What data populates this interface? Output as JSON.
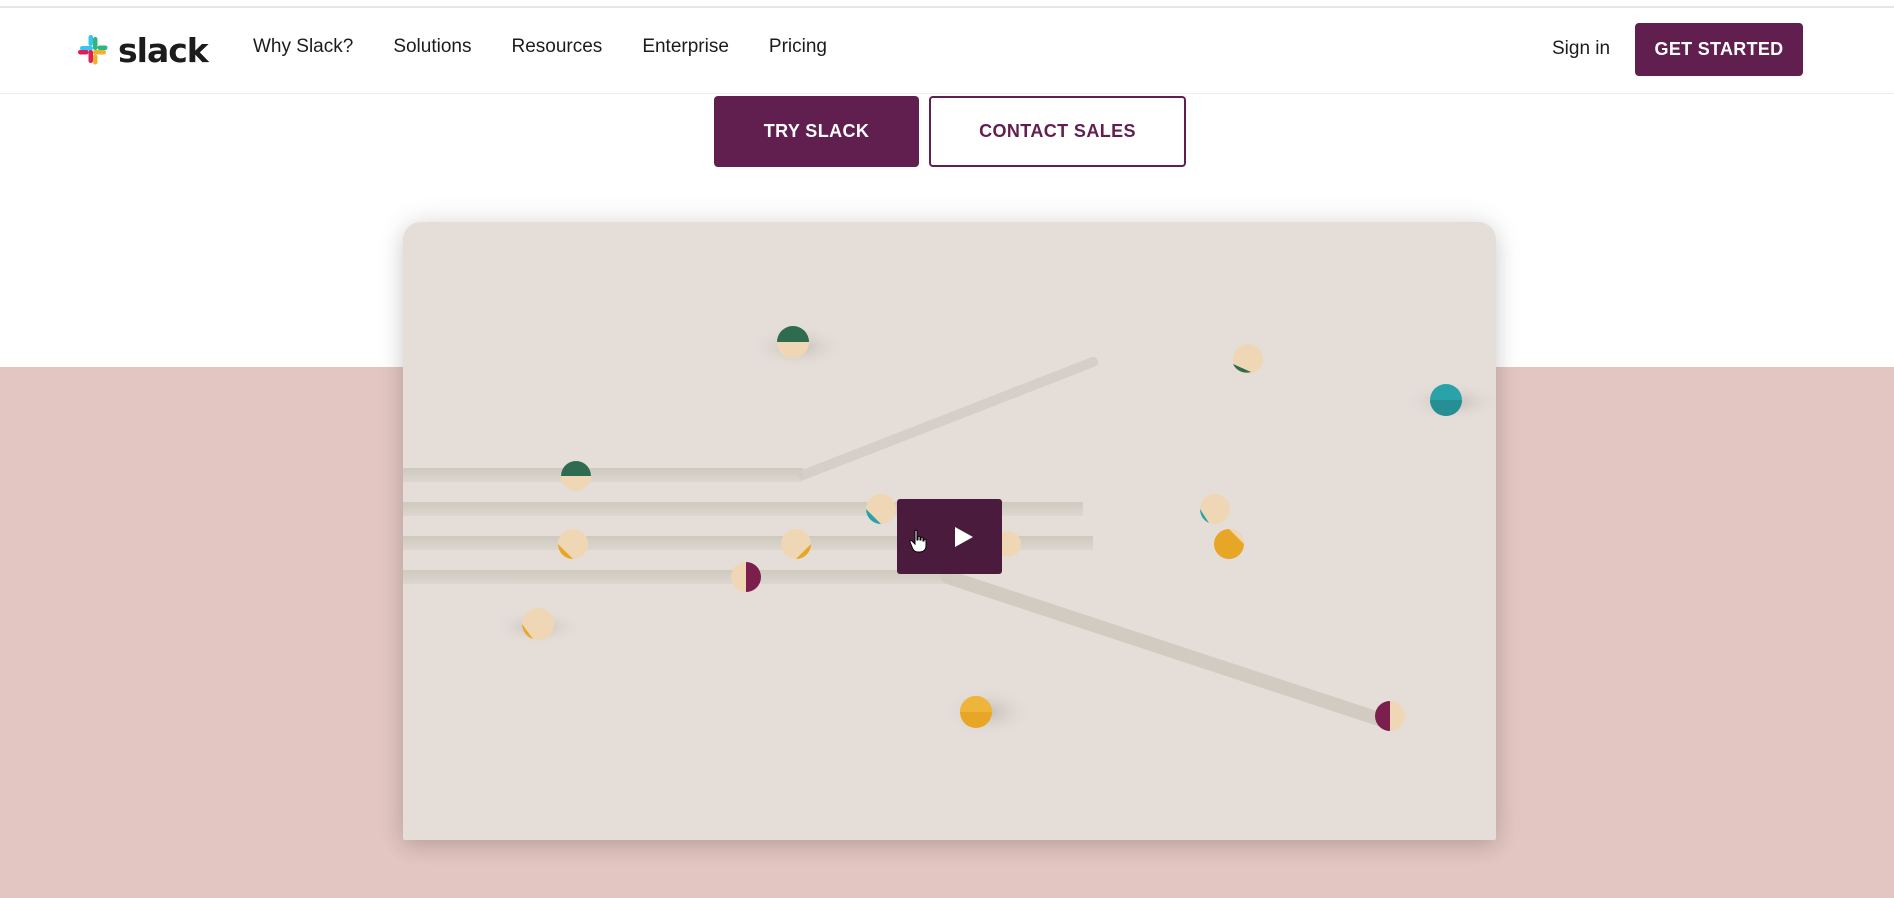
{
  "header": {
    "logo_text": "slack",
    "nav": [
      "Why Slack?",
      "Solutions",
      "Resources",
      "Enterprise",
      "Pricing"
    ],
    "sign_in": "Sign in",
    "get_started": "GET STARTED"
  },
  "hero": {
    "try_label": "TRY SLACK",
    "contact_label": "CONTACT SALES"
  },
  "video": {
    "play_icon": "play-icon",
    "cursor_icon": "hand-cursor-icon"
  },
  "colors": {
    "brand": "#611f4f",
    "pink_band": "#e3c6c1",
    "video_bg": "#e4ddd8",
    "green": "#2e6b4f",
    "teal": "#2aa3a8",
    "yellow": "#e8a627",
    "plum": "#7a1f4e",
    "cream": "#efd7b5"
  }
}
